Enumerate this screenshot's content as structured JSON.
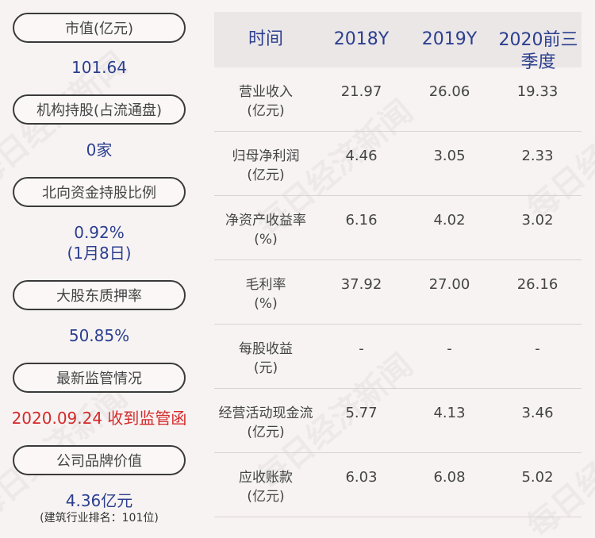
{
  "left_panel": {
    "items": [
      {
        "label": "市值(亿元)",
        "value": "101.64"
      },
      {
        "label": "机构持股(占流通盘)",
        "value": "0家"
      },
      {
        "label": "北向资金持股比例",
        "value": "0.92%",
        "value2": "(1月8日)"
      },
      {
        "label": "大股东质押率",
        "value": "50.85%"
      },
      {
        "label": "最新监管情况",
        "value": "2020.09.24 收到监管函"
      },
      {
        "label": "公司品牌价值",
        "value": "4.36亿元",
        "note": "(建筑行业排名：101位)"
      }
    ]
  },
  "table": {
    "headers": [
      "时间",
      "2018Y",
      "2019Y",
      "2020前三季度"
    ],
    "rows": [
      {
        "label": "营业收入",
        "unit": "(亿元)",
        "values": [
          "21.97",
          "26.06",
          "19.33"
        ]
      },
      {
        "label": "归母净利润",
        "unit": "(亿元)",
        "values": [
          "4.46",
          "3.05",
          "2.33"
        ]
      },
      {
        "label": "净资产收益率",
        "unit": "(%)",
        "values": [
          "6.16",
          "4.02",
          "3.02"
        ]
      },
      {
        "label": "毛利率",
        "unit": "(%)",
        "values": [
          "37.92",
          "27.00",
          "26.16"
        ]
      },
      {
        "label": "每股收益",
        "unit": "(元)",
        "values": [
          "-",
          "-",
          "-"
        ]
      },
      {
        "label": "经营活动现金流",
        "unit": "(亿元)",
        "values": [
          "5.77",
          "4.13",
          "3.46"
        ]
      },
      {
        "label": "应收账款",
        "unit": "(亿元)",
        "values": [
          "6.03",
          "6.08",
          "5.02"
        ]
      }
    ]
  },
  "watermark": "每日经济新闻",
  "colors": {
    "value_blue": "#2b3f8f",
    "alert_red": "#d42a2a",
    "background": "#f8f3f3"
  }
}
